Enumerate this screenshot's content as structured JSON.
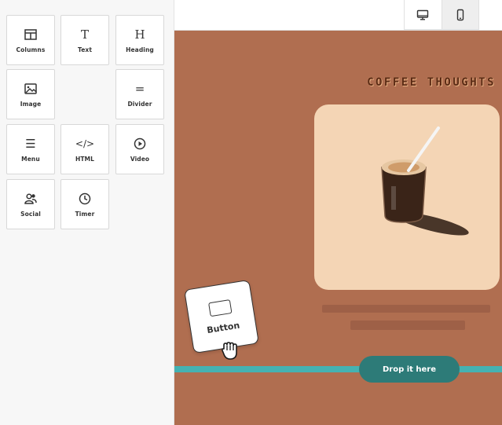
{
  "palette": {
    "tiles": [
      {
        "label": "Columns",
        "icon": "columns-icon"
      },
      {
        "label": "Text",
        "icon": "text-icon",
        "glyph": "T"
      },
      {
        "label": "Heading",
        "icon": "heading-icon",
        "glyph": "H"
      },
      {
        "label": "Image",
        "icon": "image-icon"
      },
      {
        "label": "Divider",
        "icon": "divider-icon",
        "glyph": "="
      },
      {
        "label": "Menu",
        "icon": "menu-icon",
        "glyph": "☰"
      },
      {
        "label": "HTML",
        "icon": "html-code-icon",
        "glyph": "</>"
      },
      {
        "label": "Video",
        "icon": "video-play-icon"
      },
      {
        "label": "Social",
        "icon": "social-users-icon"
      },
      {
        "label": "Timer",
        "icon": "timer-clock-icon"
      }
    ]
  },
  "toolbar": {
    "devices": [
      {
        "name": "desktop",
        "icon": "desktop-monitor-icon",
        "active": false
      },
      {
        "name": "mobile",
        "icon": "mobile-phone-icon",
        "active": true
      }
    ]
  },
  "canvas": {
    "headline": "COFFEE THOUGHTS",
    "drop_label": "Drop it here",
    "colors": {
      "background": "#b06e50",
      "photo_bg": "#f4d5b5",
      "drop_line": "#45b2b2",
      "drop_pill": "#2d7b78"
    }
  },
  "drag": {
    "label": "Button",
    "icon": "button-icon",
    "cursor": "grab-hand-icon"
  }
}
